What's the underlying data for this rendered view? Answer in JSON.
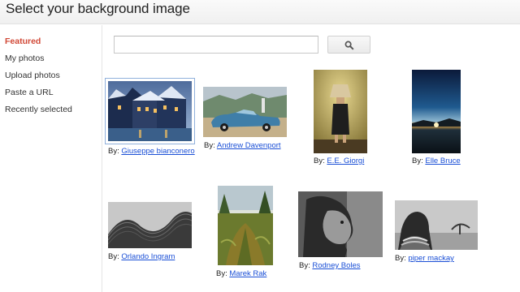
{
  "header": {
    "title": "Select your background image"
  },
  "sidebar": {
    "items": [
      {
        "label": "Featured",
        "active": true
      },
      {
        "label": "My photos"
      },
      {
        "label": "Upload photos"
      },
      {
        "label": "Paste a URL"
      },
      {
        "label": "Recently selected"
      }
    ]
  },
  "search": {
    "value": "",
    "placeholder": "",
    "icon": "magnifier-icon"
  },
  "gallery": {
    "by_prefix": "By:",
    "photos": [
      {
        "author": "Giuseppe bianconero",
        "subject": "snowy-canal-village",
        "selected": true
      },
      {
        "author": "Andrew Davenport",
        "subject": "vintage-blue-car"
      },
      {
        "author": "E.E. Giorgi",
        "subject": "figure-with-lampshade"
      },
      {
        "author": "Elle Bruce",
        "subject": "sunset-over-water"
      },
      {
        "author": "Orlando Ingram",
        "subject": "wavy-architecture-bw"
      },
      {
        "author": "Marek Rak",
        "subject": "ferns-and-trees"
      },
      {
        "author": "Rodney Boles",
        "subject": "bw-portrait-profile"
      },
      {
        "author": "piper mackay",
        "subject": "tribal-portrait-savanna"
      }
    ]
  },
  "colors": {
    "active_nav": "#d14836",
    "link": "#1a4fd6",
    "selection_border": "#90b0dc"
  }
}
